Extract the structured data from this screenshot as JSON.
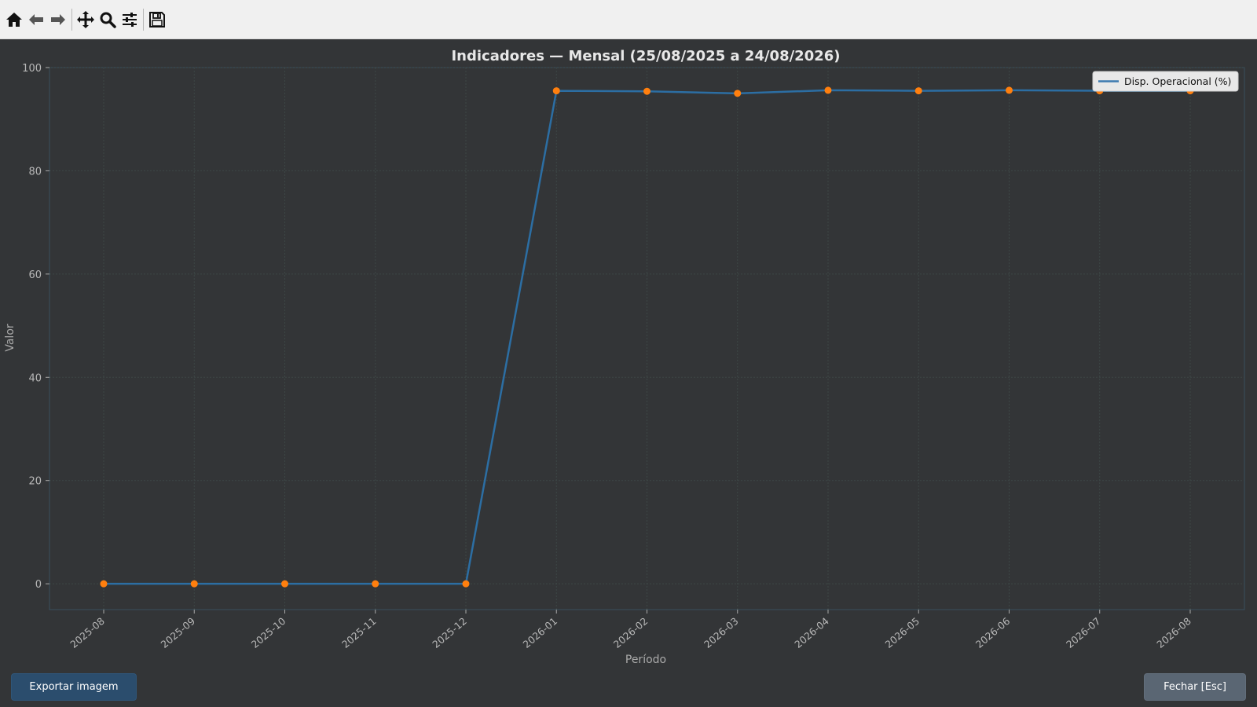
{
  "toolbar": {
    "icons": [
      "home-icon",
      "back-arrow-icon",
      "forward-arrow-icon",
      "pan-icon",
      "zoom-icon",
      "configure-subplots-icon",
      "save-icon"
    ]
  },
  "colors": {
    "background": "#333537",
    "line": "#2c6ea3",
    "marker": "#ff7f0e",
    "text": "#e8e8e8",
    "tick_text": "#b8b8b8"
  },
  "chart_data": {
    "type": "line",
    "title": "Indicadores — Mensal (25/08/2025 a 24/08/2026)",
    "xlabel": "Período",
    "ylabel": "Valor",
    "categories": [
      "2025-08",
      "2025-09",
      "2025-10",
      "2025-11",
      "2025-12",
      "2026-01",
      "2026-02",
      "2026-03",
      "2026-04",
      "2026-05",
      "2026-06",
      "2026-07",
      "2026-08"
    ],
    "series": [
      {
        "name": "Disp. Operacional (%)",
        "values": [
          0,
          0,
          0,
          0,
          0,
          95.5,
          95.4,
          95.0,
          95.6,
          95.5,
          95.6,
          95.5,
          95.5
        ]
      }
    ],
    "ylim": [
      -5,
      100
    ],
    "yticks": [
      0,
      20,
      40,
      60,
      80,
      100
    ],
    "grid": true,
    "legend": "top-right"
  },
  "footer": {
    "export_label": "Exportar imagem",
    "close_label": "Fechar [Esc]"
  }
}
